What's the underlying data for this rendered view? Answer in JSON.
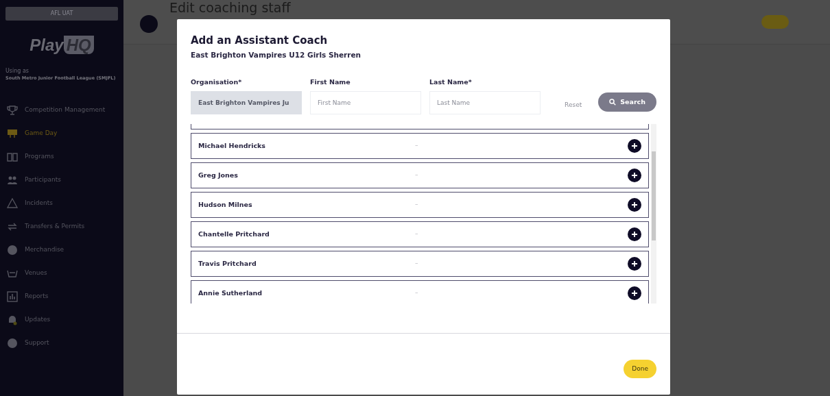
{
  "environment_badge": "AFL UAT",
  "logo": {
    "part_1": "Play",
    "part_2": "HQ"
  },
  "account": {
    "caption": "Using as",
    "organisation": "South Metro Junior Football League (SMJFL)"
  },
  "sidebar": {
    "items": [
      {
        "label": "Competition Management",
        "selected": false
      },
      {
        "label": "Game Day",
        "selected": true
      },
      {
        "label": "Programs",
        "selected": false
      },
      {
        "label": "Participants",
        "selected": false
      },
      {
        "label": "Incidents",
        "selected": false
      },
      {
        "label": "Transfers & Permits",
        "selected": false
      },
      {
        "label": "Merchandise",
        "selected": false
      },
      {
        "label": "Venues",
        "selected": false
      },
      {
        "label": "Reports",
        "selected": false
      },
      {
        "label": "Updates",
        "selected": false
      },
      {
        "label": "Support",
        "selected": false
      }
    ]
  },
  "page": {
    "title": "Edit coaching staff"
  },
  "modal": {
    "title": "Add an Assistant Coach",
    "subtitle": "East Brighton Vampires U12 Girls Sherren",
    "fields": [
      {
        "label": "Organisation*",
        "value": "East Brighton Vampires Ju",
        "disabled": true
      },
      {
        "label": "First Name",
        "placeholder": "First Name",
        "disabled": false
      },
      {
        "label": "Last Name*",
        "placeholder": "Last Name",
        "disabled": false
      }
    ],
    "reset_button": {
      "label": "Reset",
      "disabled": true
    },
    "search_button": {
      "label": "Search"
    },
    "results": [
      {
        "name": "Michael Hendricks",
        "detail": "–"
      },
      {
        "name": "Greg Jones",
        "detail": "–"
      },
      {
        "name": "Hudson Milnes",
        "detail": "–"
      },
      {
        "name": "Chantelle Pritchard",
        "detail": "–"
      },
      {
        "name": "Travis Pritchard",
        "detail": "–"
      },
      {
        "name": "Annie Sutherland",
        "detail": "–"
      }
    ],
    "done_button": {
      "label": "Done"
    }
  }
}
